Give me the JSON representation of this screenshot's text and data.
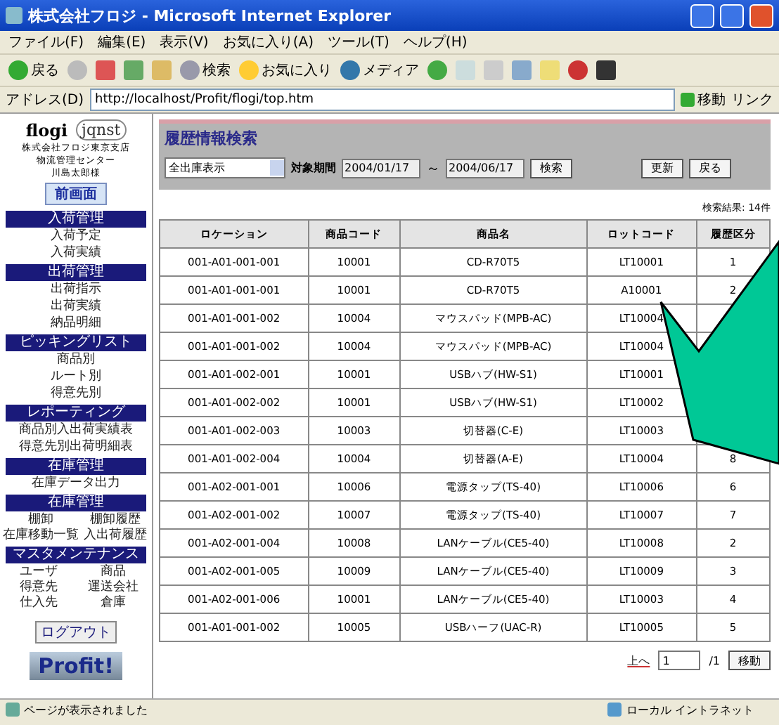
{
  "window": {
    "title": "株式会社フロジ - Microsoft Internet Explorer"
  },
  "menu": [
    "ファイル(F)",
    "編集(E)",
    "表示(V)",
    "お気に入り(A)",
    "ツール(T)",
    "ヘルプ(H)"
  ],
  "toolbar": {
    "back": "戻る",
    "search": "検索",
    "favorites": "お気に入り",
    "media": "メディア"
  },
  "address": {
    "label": "アドレス(D)",
    "url": "http://localhost/Profit/flogi/top.htm",
    "go": "移動",
    "links": "リンク"
  },
  "sidebar": {
    "logo": "flogi",
    "logo2": "jqnst",
    "company": [
      "株式会社フロジ東京支店",
      "物流管理センター",
      "川島太郎様"
    ],
    "top_button": "前画面",
    "sections": [
      {
        "title": "入荷管理",
        "kind": "list",
        "items": [
          "入荷予定",
          "入荷実績"
        ]
      },
      {
        "title": "出荷管理",
        "kind": "list",
        "items": [
          "出荷指示",
          "出荷実績",
          "納品明細"
        ]
      },
      {
        "title": "ピッキングリスト",
        "kind": "list",
        "items": [
          "商品別",
          "ルート別",
          "得意先別"
        ]
      },
      {
        "title": "レポーティング",
        "kind": "list",
        "items": [
          "商品別入出荷実績表",
          "得意先別出荷明細表"
        ]
      },
      {
        "title": "在庫管理",
        "kind": "list",
        "items": [
          "在庫データ出力"
        ]
      },
      {
        "title": "在庫管理",
        "kind": "grid",
        "items": [
          "棚卸",
          "棚卸履歴",
          "在庫移動一覧",
          "入出荷履歴"
        ]
      },
      {
        "title": "マスタメンテナンス",
        "kind": "grid",
        "items": [
          "ユーザ",
          "商品",
          "得意先",
          "運送会社",
          "仕入先",
          "倉庫"
        ]
      }
    ],
    "logout": "ログアウト",
    "brand": "Profit!"
  },
  "main": {
    "title": "履歴情報検索",
    "filter": {
      "value": "全出庫表示",
      "label": "対象期間",
      "from": "2004/01/17",
      "sep": "～",
      "to": "2004/06/17",
      "search": "検索"
    },
    "actions": [
      "更新",
      "戻る"
    ],
    "result_count": "検索結果: 14件",
    "table": {
      "columns": [
        "ロケーション",
        "商品コード",
        "商品名",
        "ロットコード",
        "履歴区分"
      ],
      "rows": [
        [
          "001-A01-001-001",
          "10001",
          "CD-R70T5",
          "LT10001",
          "1"
        ],
        [
          "001-A01-001-001",
          "10001",
          "CD-R70T5",
          "A10001",
          "2"
        ],
        [
          "001-A01-001-002",
          "10004",
          "マウスパッド(MPB-AC)",
          "LT10004"
        ],
        [
          "001-A01-001-002",
          "10004",
          "マウスパッド(MPB-AC)",
          "LT10004"
        ],
        [
          "001-A01-002-001",
          "10001",
          "USBハブ(HW-S1)",
          "LT10001"
        ],
        [
          "001-A01-002-002",
          "10001",
          "USBハブ(HW-S1)",
          "LT10002"
        ],
        [
          "001-A01-002-003",
          "10003",
          "切替器(C-E)",
          "LT10003"
        ],
        [
          "001-A01-002-004",
          "10004",
          "切替器(A-E)",
          "LT10004",
          "8"
        ],
        [
          "001-A02-001-001",
          "10006",
          "電源タップ(TS-40)",
          "LT10006",
          "6"
        ],
        [
          "001-A02-001-002",
          "10007",
          "電源タップ(TS-40)",
          "LT10007",
          "7"
        ],
        [
          "001-A02-001-004",
          "10008",
          "LANケーブル(CE5-40)",
          "LT10008",
          "2"
        ],
        [
          "001-A02-001-005",
          "10009",
          "LANケーブル(CE5-40)",
          "LT10009",
          "3"
        ],
        [
          "001-A02-001-006",
          "10001",
          "LANケーブル(CE5-40)",
          "LT10003",
          "4"
        ],
        [
          "001-A01-001-002",
          "10005",
          "USBハーフ(UAC-R)",
          "LT10005",
          "5"
        ]
      ]
    },
    "pager": {
      "link": "上へ",
      "page": "1",
      "total": "/1",
      "go": "移動"
    }
  },
  "status_bar": {
    "text": "ページが表示されました",
    "zone": "ローカル イントラネット"
  }
}
